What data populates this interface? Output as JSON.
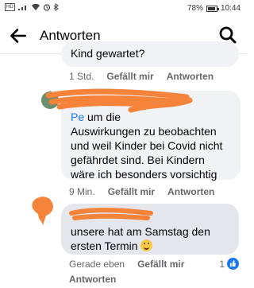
{
  "status_bar": {
    "network_tag": "HD",
    "battery_percent": "78%",
    "time": "10:44",
    "icons": [
      "signal-icon",
      "wifi-icon",
      "alarm-icon",
      "bluetooth-icon",
      "battery-icon"
    ]
  },
  "header": {
    "title": "Antworten",
    "back_icon": "arrow-left-icon",
    "search_icon": "search-icon"
  },
  "comments": [
    {
      "partial_text": "Kind gewartet?",
      "time": "1 Std.",
      "like_label": "Gefällt mir",
      "reply_label": "Antworten"
    },
    {
      "text_link_fragment": "Pe",
      "text_line1_rest": " um die",
      "text": "Auswirkungen zu beobachten und weil Kinder bei Covid nicht gefährdet sind. Bei Kindern wäre ich besonders vorsichtig",
      "time": "9 Min.",
      "like_label": "Gefällt mir",
      "reply_label": "Antworten"
    },
    {
      "text": "unsere hat am Samstag den ersten Termin",
      "emoji": "slightly-smiling-face",
      "time": "Gerade eben",
      "like_label": "Gefällt mir",
      "reply_label": "Antworten",
      "reaction_count": "1"
    }
  ],
  "colors": {
    "accent": "#1877f2",
    "bubble": "#f0f2f5",
    "bubble_own": "#e4e6eb",
    "redaction": "#f5833a"
  }
}
